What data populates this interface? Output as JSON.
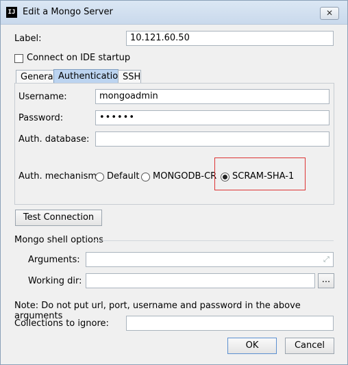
{
  "window": {
    "title": "Edit a Mongo Server",
    "icon": "IJ",
    "close": "✕"
  },
  "label_row": {
    "label": "Label:",
    "value": "10.121.60.50"
  },
  "connect_startup": {
    "label": "Connect on IDE startup",
    "checked": false
  },
  "tabs": [
    {
      "label": "General",
      "active": false
    },
    {
      "label": "Authentication",
      "active": true
    },
    {
      "label": "SSH",
      "active": false
    }
  ],
  "auth": {
    "username_label": "Username:",
    "username": "mongoadmin",
    "password_label": "Password:",
    "password": "••••••",
    "authdb_label": "Auth. database:",
    "authdb": "",
    "mechanism_label": "Auth. mechanism:",
    "mechanisms": [
      {
        "label": "Default",
        "selected": false
      },
      {
        "label": "MONGODB-CR",
        "selected": false
      },
      {
        "label": "SCRAM-SHA-1",
        "selected": true
      }
    ],
    "highlight_color": "#dd3333"
  },
  "test_connection": "Test Connection",
  "shell": {
    "section_label": "Mongo shell options",
    "arguments_label": "Arguments:",
    "arguments": "",
    "working_dir_label": "Working dir:",
    "working_dir": "",
    "browse": "...",
    "note": "Note: Do not put url, port, username and password in the above arguments"
  },
  "collections": {
    "label": "Collections to ignore:",
    "value": ""
  },
  "buttons": {
    "ok": "OK",
    "cancel": "Cancel"
  },
  "colors": {
    "active_tab": "#bcd4f0",
    "titlebar": "#c9d9ec",
    "default_button_border": "#5b8fd0"
  }
}
